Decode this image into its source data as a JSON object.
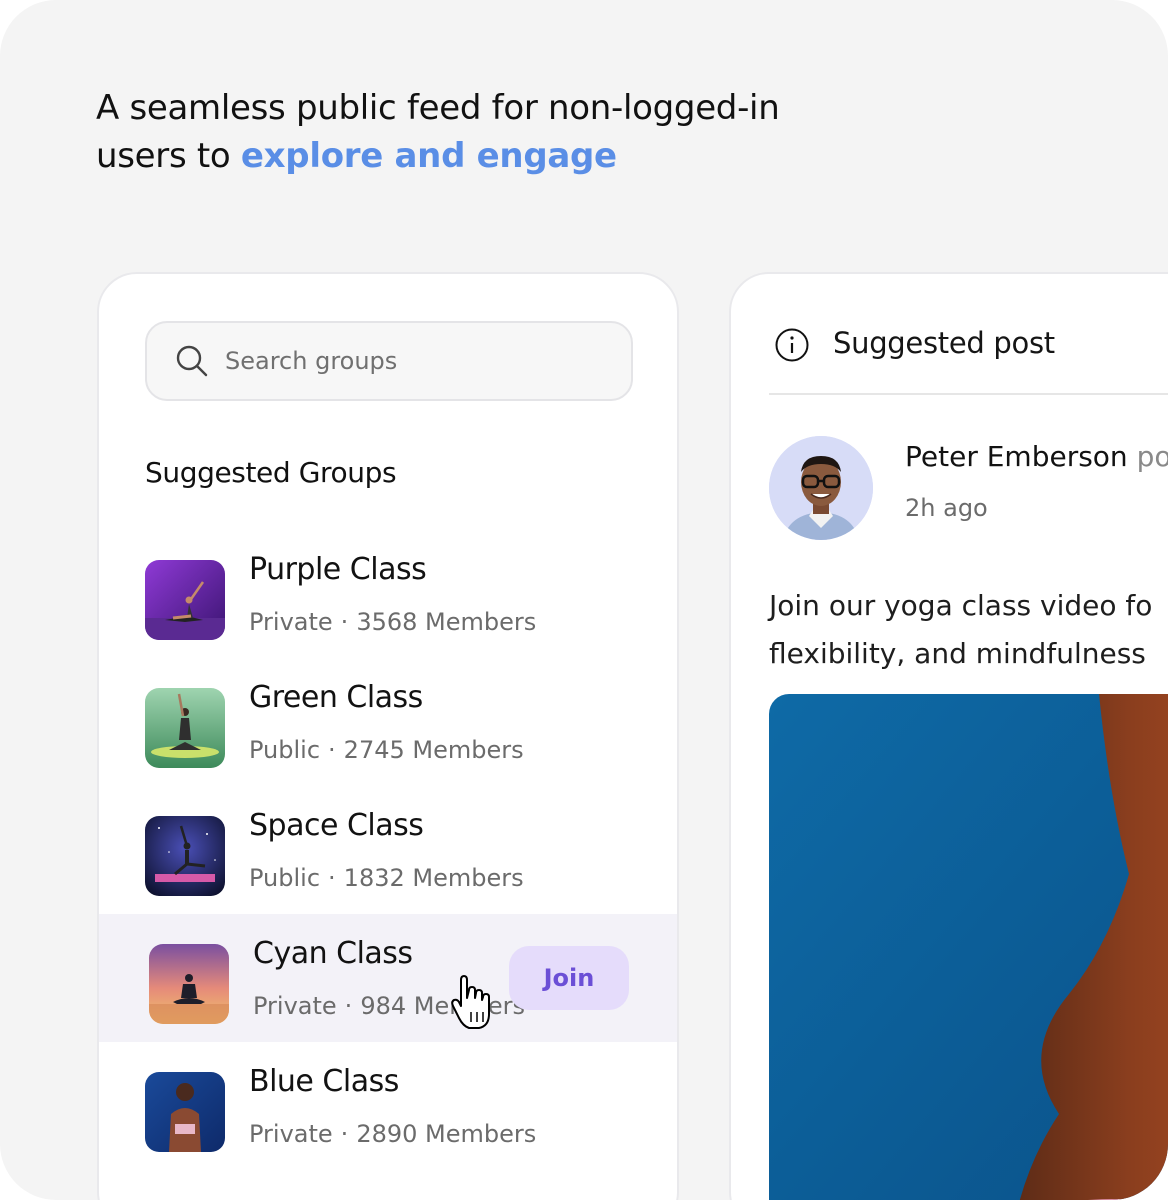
{
  "headline": {
    "text_before": "A seamless public feed for non-logged-in users to ",
    "accent": "explore and engage"
  },
  "search": {
    "placeholder": "Search groups",
    "icon": "search-icon"
  },
  "groups_section": {
    "title": "Suggested Groups",
    "items": [
      {
        "name": "Purple Class",
        "privacy": "Private",
        "members": "3568 Members"
      },
      {
        "name": "Green Class",
        "privacy": "Public",
        "members": "2745 Members"
      },
      {
        "name": "Space Class",
        "privacy": "Public",
        "members": "1832 Members"
      },
      {
        "name": "Cyan Class",
        "privacy": "Private",
        "members": "984 Members",
        "join_label": "Join"
      },
      {
        "name": "Blue Class",
        "privacy": "Private",
        "members": "2890 Members"
      }
    ],
    "separator": "·"
  },
  "post": {
    "header_label": "Suggested post",
    "header_icon": "info-icon",
    "author": "Peter Emberson",
    "author_suffix": "po",
    "time": "2h ago",
    "text_line1": "Join our yoga class video fo",
    "text_line2": "flexibility, and mindfulness"
  },
  "colors": {
    "accent": "#5a8ee6",
    "join_bg": "#e5dcfb",
    "join_text": "#6b4fd6",
    "active_row": "#f3f2f8"
  }
}
